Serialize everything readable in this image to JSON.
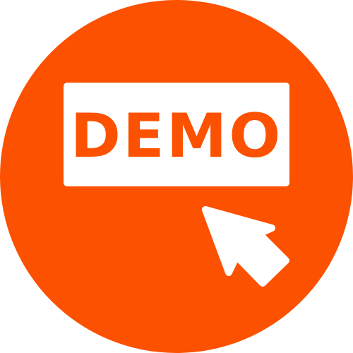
{
  "badge": {
    "label": "DEMO",
    "background_color": "#fc5100",
    "box_color": "#ffffff",
    "text_color": "#fc5100",
    "cursor_color": "#ffffff"
  },
  "icons": {
    "pointer": "arrow-cursor-icon"
  }
}
